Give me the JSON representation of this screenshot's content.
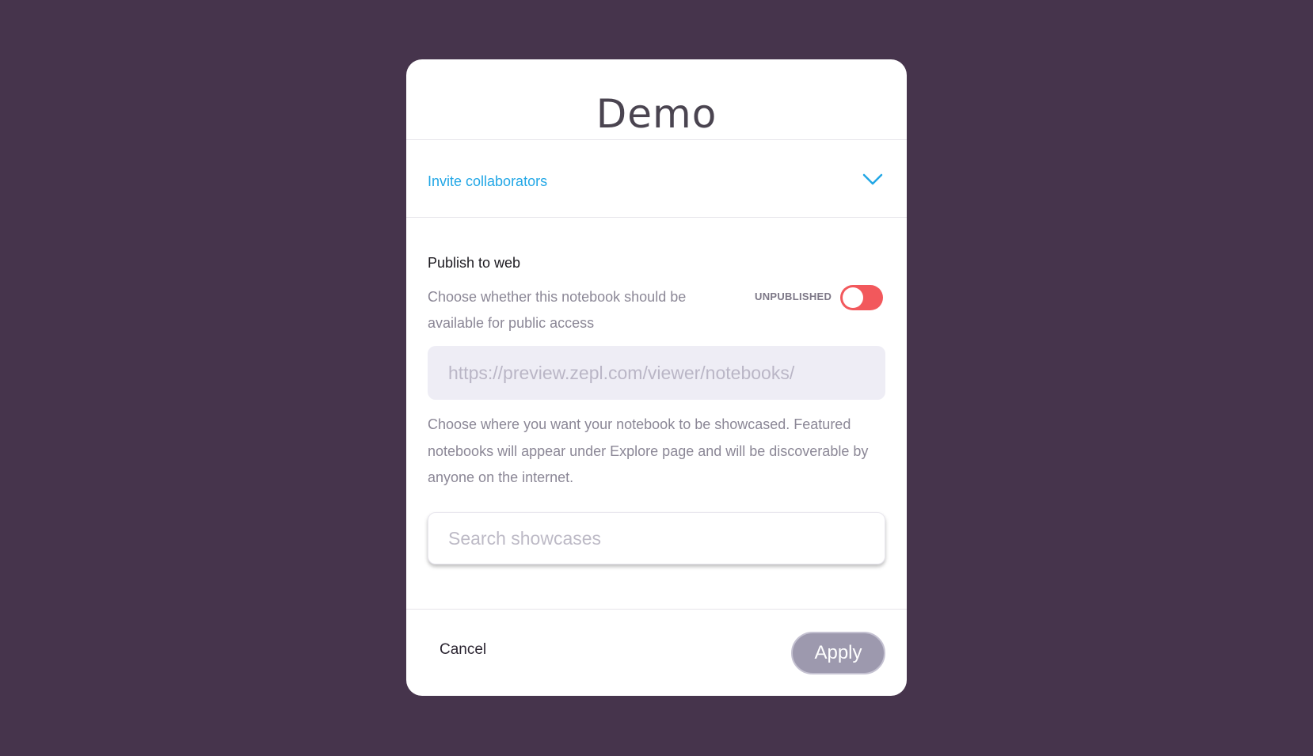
{
  "modal": {
    "title": "Demo"
  },
  "invite": {
    "label": "Invite collaborators",
    "color": "#22a7e6"
  },
  "publish": {
    "heading": "Publish to web",
    "description": "Choose whether this notebook should be available for public access",
    "status_label": "UNPUBLISHED",
    "toggle_on": false,
    "toggle_color": "#f2585c",
    "url_placeholder": "https://preview.zepl.com/viewer/notebooks/"
  },
  "showcase": {
    "description": "Choose where you want your notebook to be showcased. Featured notebooks will appear under Explore page and will be discoverable by anyone on the internet.",
    "search_placeholder": "Search showcases"
  },
  "footer": {
    "cancel_label": "Cancel",
    "apply_label": "Apply"
  },
  "colors": {
    "background": "#46344c",
    "apply_button": "#9d99ae"
  }
}
